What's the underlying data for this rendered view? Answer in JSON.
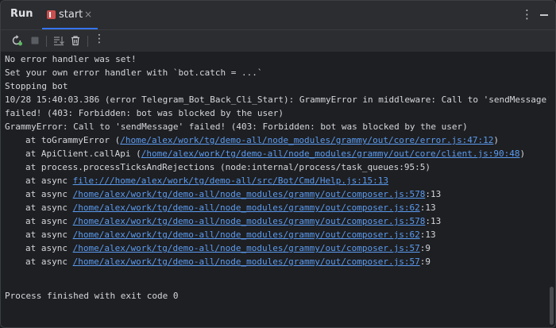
{
  "header": {
    "run_label": "Run",
    "tab_label": "start",
    "tab_close": "×",
    "more": "⋮"
  },
  "toolbar": {
    "more": "⋮"
  },
  "colors": {
    "background": "#1e1f22",
    "panel": "#2b2d30",
    "accent": "#3574f0",
    "link": "#5b9bf0",
    "text": "#d4d7dc"
  },
  "console": {
    "lines": [
      {
        "text": "No error handler was set!"
      },
      {
        "text": "Set your own error handler with `bot.catch = ...`"
      },
      {
        "text": "Stopping bot"
      },
      {
        "text": "10/28 15:40:03.386 (error Telegram_Bot_Back_Cli_Start): GrammyError in middleware: Call to 'sendMessage'"
      },
      {
        "text": "failed! (403: Forbidden: bot was blocked by the user)"
      },
      {
        "text": "GrammyError: Call to 'sendMessage' failed! (403: Forbidden: bot was blocked by the user)"
      }
    ],
    "stack": [
      {
        "prefix": "at toGrammyError (",
        "link": "/home/alex/work/tg/demo-all/node_modules/grammy/out/core/error.js:47:12",
        "suffix": ")"
      },
      {
        "prefix": "at ApiClient.callApi (",
        "link": "/home/alex/work/tg/demo-all/node_modules/grammy/out/core/client.js:90:48",
        "suffix": ")"
      },
      {
        "prefix": "at process.processTicksAndRejections (node:internal/process/task_queues:95:5)",
        "link": "",
        "suffix": ""
      },
      {
        "prefix": "at async ",
        "link": "file:///home/alex/work/tg/demo-all/src/Bot/Cmd/Help.js:15:13",
        "suffix": ""
      },
      {
        "prefix": "at async ",
        "link": "/home/alex/work/tg/demo-all/node_modules/grammy/out/composer.js:578",
        "suffix": ":13"
      },
      {
        "prefix": "at async ",
        "link": "/home/alex/work/tg/demo-all/node_modules/grammy/out/composer.js:62",
        "suffix": ":13"
      },
      {
        "prefix": "at async ",
        "link": "/home/alex/work/tg/demo-all/node_modules/grammy/out/composer.js:578",
        "suffix": ":13"
      },
      {
        "prefix": "at async ",
        "link": "/home/alex/work/tg/demo-all/node_modules/grammy/out/composer.js:62",
        "suffix": ":13"
      },
      {
        "prefix": "at async ",
        "link": "/home/alex/work/tg/demo-all/node_modules/grammy/out/composer.js:57",
        "suffix": ":9"
      },
      {
        "prefix": "at async ",
        "link": "/home/alex/work/tg/demo-all/node_modules/grammy/out/composer.js:57",
        "suffix": ":9"
      }
    ],
    "exit_line": "Process finished with exit code 0"
  }
}
